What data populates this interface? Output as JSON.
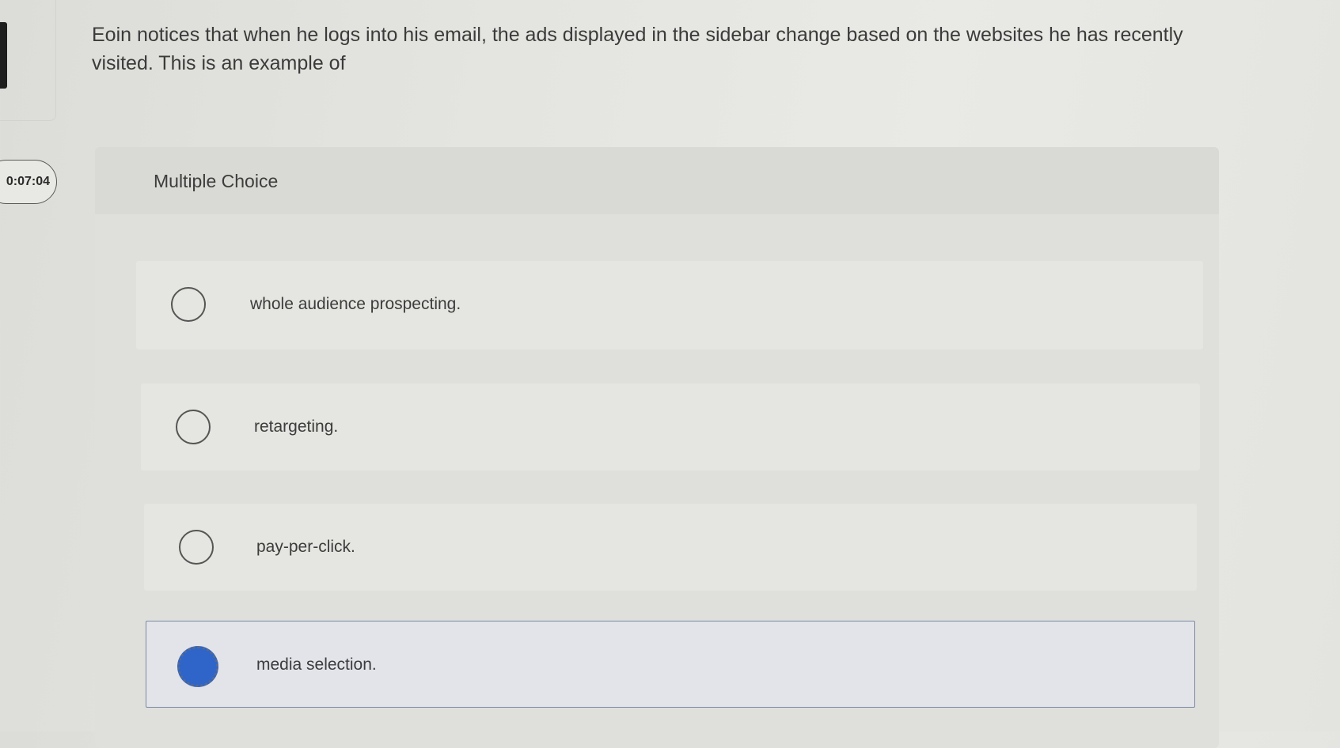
{
  "timer": {
    "value": "0:07:04"
  },
  "question": {
    "text": "Eoin notices that when he logs into his email, the ads displayed in the sidebar change based on the websites he has recently visited. This is an example of"
  },
  "multiple_choice": {
    "label": "Multiple Choice",
    "options": [
      {
        "label": "whole audience prospecting.",
        "selected": false
      },
      {
        "label": "retargeting.",
        "selected": false
      },
      {
        "label": "pay-per-click.",
        "selected": false
      },
      {
        "label": "media selection.",
        "selected": true
      }
    ]
  },
  "colors": {
    "selected_radio_fill": "#2f65c8",
    "selected_border": "#7d8aa3"
  }
}
